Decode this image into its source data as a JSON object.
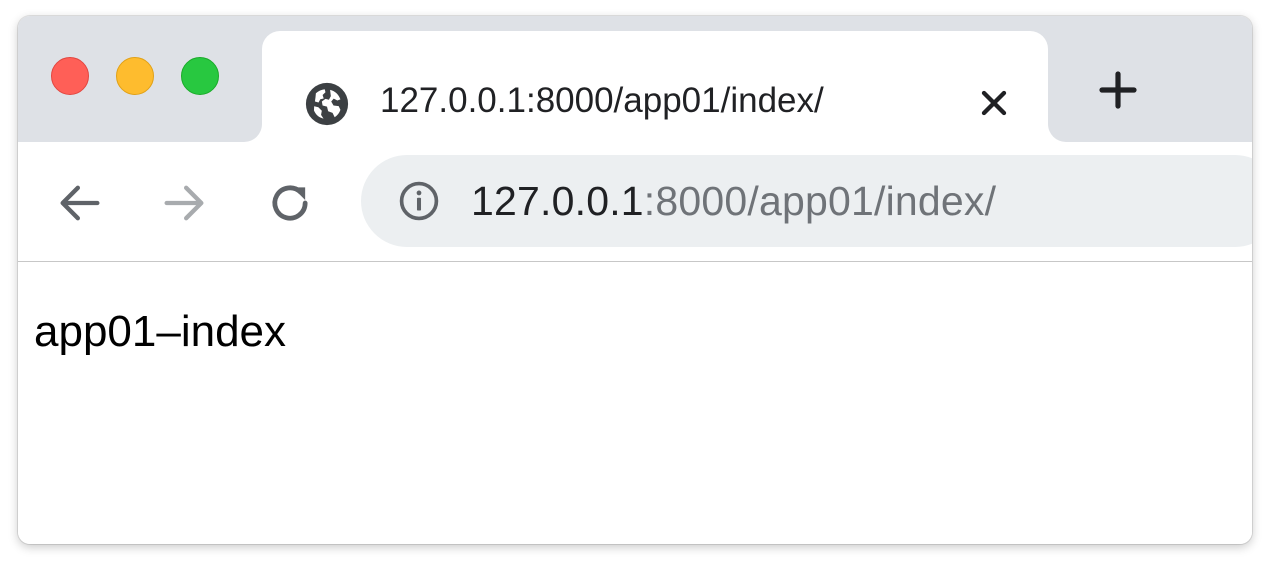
{
  "tab": {
    "title": "127.0.0.1:8000/app01/index/",
    "favicon": "globe-icon",
    "close_icon": "close-icon"
  },
  "new_tab_icon": "plus-icon",
  "toolbar": {
    "back_icon": "arrow-left-icon",
    "forward_icon": "arrow-right-icon",
    "reload_icon": "reload-icon"
  },
  "omnibox": {
    "info_icon": "info-icon",
    "url_host": "127.0.0.1",
    "url_rest": ":8000/app01/index/"
  },
  "page": {
    "body_text": "app01–index"
  },
  "colors": {
    "tabstrip_bg": "#dee1e6",
    "omnibox_bg": "#eceff1",
    "traffic_close": "#ff5f57",
    "traffic_minimize": "#febc2e",
    "traffic_maximize": "#28c840",
    "url_host_text": "#202124",
    "url_rest_text": "#6f7378"
  }
}
